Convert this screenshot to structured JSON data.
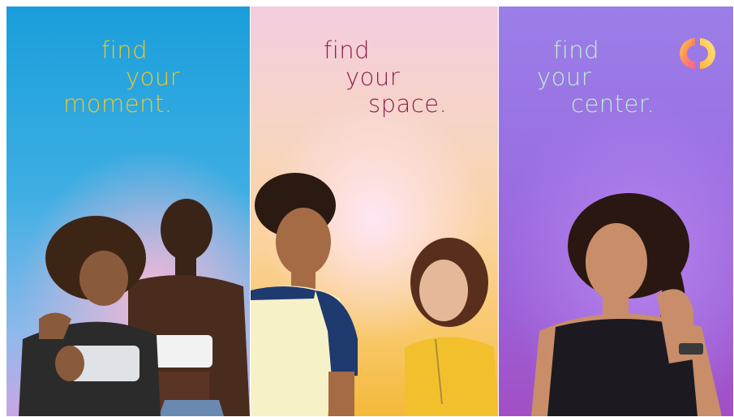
{
  "panels": [
    {
      "tagline": [
        "find",
        "your",
        "moment."
      ],
      "colors": {
        "background_top": "#1a9edb",
        "background_bottom": "#c9a6e6",
        "text": "#f1c62a"
      }
    },
    {
      "tagline": [
        "find",
        "your",
        "space."
      ],
      "colors": {
        "background_top": "#f4cde0",
        "background_bottom": "#f4b93a",
        "text": "#8a1f4e"
      }
    },
    {
      "tagline": [
        "find",
        "your",
        "center."
      ],
      "colors": {
        "background_top": "#9b7ee8",
        "background_bottom": "#a24fc4",
        "text": "#bff0d0"
      },
      "logo_icon": "ring-logo-icon"
    }
  ]
}
